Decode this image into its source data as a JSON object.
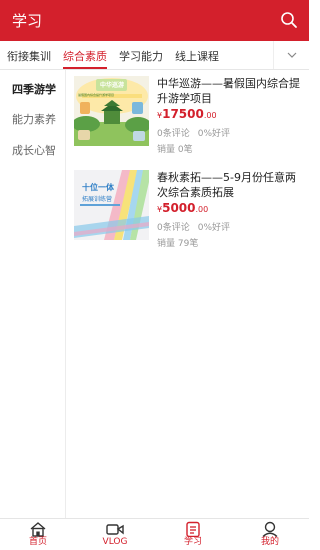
{
  "header": {
    "title": "学习"
  },
  "tabs": [
    {
      "label": "衔接集训",
      "active": false
    },
    {
      "label": "综合素质",
      "active": true
    },
    {
      "label": "学习能力",
      "active": false
    },
    {
      "label": "线上课程",
      "active": false
    }
  ],
  "sidebar": {
    "items": [
      {
        "label": "四季游学",
        "active": true
      },
      {
        "label": "能力素养",
        "active": false
      },
      {
        "label": "成长心智",
        "active": false
      }
    ]
  },
  "products": [
    {
      "title": "中华巡游——暑假国内综合提升游学项目",
      "currency": "¥",
      "price_int": "17500",
      "price_dec": ".00",
      "comments": "0条评论",
      "rating": "0%好评",
      "sales": "销量 0笔",
      "thumb_text": "中华巡游",
      "thumb_subtext": "暑假国内综合提升游学项目"
    },
    {
      "title": "春秋素拓——5-9月份任意两次综合素质拓展",
      "currency": "¥",
      "price_int": "5000",
      "price_dec": ".00",
      "comments": "0条评论",
      "rating": "0%好评",
      "sales": "销量 79笔",
      "thumb_text": "十位一体",
      "thumb_subtext": "拓展训练营"
    }
  ],
  "tabbar": [
    {
      "label": "首页",
      "icon": "home-icon"
    },
    {
      "label": "VLOG",
      "icon": "video-icon"
    },
    {
      "label": "学习",
      "icon": "study-icon"
    },
    {
      "label": "我的",
      "icon": "user-icon"
    }
  ],
  "colors": {
    "brand": "#d3202c"
  }
}
